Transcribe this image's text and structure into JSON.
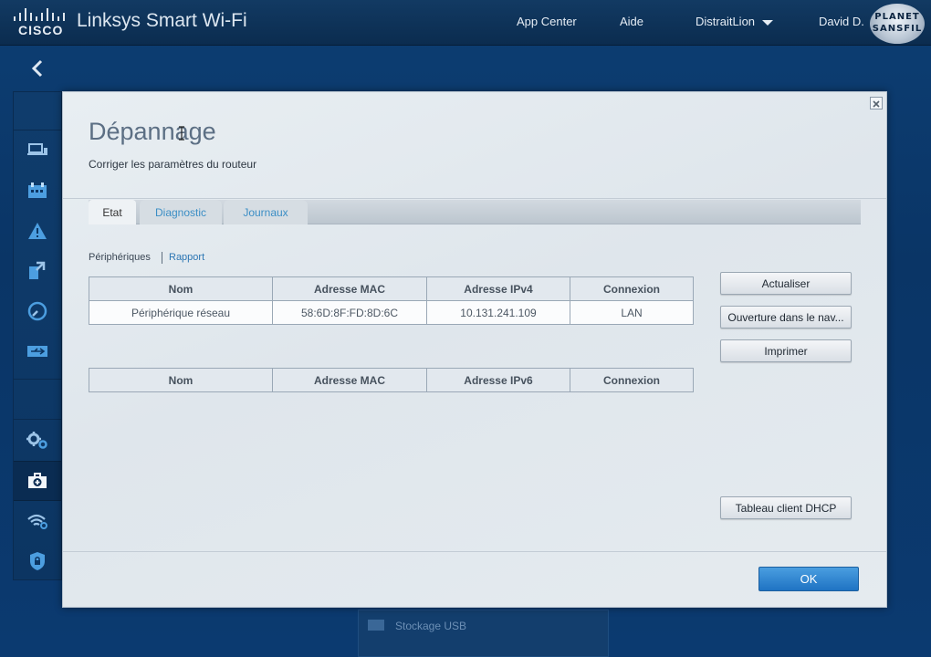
{
  "header": {
    "brand": "cisco",
    "app_title": "Linksys Smart Wi-Fi",
    "nav": {
      "app_center": "App Center",
      "help": "Aide",
      "router_name": "DistraitLion",
      "user": "David D."
    },
    "badge": {
      "line1": "PLANET",
      "line2": "SANSFIL"
    }
  },
  "sidebar": {
    "back_icon": "chevron-left-icon",
    "items": [
      {
        "icon": "devices-icon"
      },
      {
        "icon": "calendar-icon"
      },
      {
        "icon": "warning-icon"
      },
      {
        "icon": "transfer-icon"
      },
      {
        "icon": "speedometer-icon"
      },
      {
        "icon": "usb-icon"
      },
      {
        "icon": "settings-gears-icon"
      },
      {
        "icon": "first-aid-kit-icon",
        "active": true
      },
      {
        "icon": "wifi-settings-icon"
      },
      {
        "icon": "security-shield-icon"
      }
    ]
  },
  "background_widget": {
    "label": "Stockage USB"
  },
  "modal": {
    "title": "Dépannage",
    "subtitle": "Corriger les paramètres du routeur",
    "tabs": [
      {
        "label": "Etat",
        "active": true
      },
      {
        "label": "Diagnostic",
        "active": false
      },
      {
        "label": "Journaux",
        "active": false
      }
    ],
    "subnav": {
      "current": "Périphériques",
      "link": "Rapport"
    },
    "ipv4_table": {
      "headers": [
        "Nom",
        "Adresse MAC",
        "Adresse IPv4",
        "Connexion"
      ],
      "rows": [
        [
          "Périphérique réseau",
          "58:6D:8F:FD:8D:6C",
          "10.131.241.109",
          "LAN"
        ]
      ]
    },
    "ipv6_table": {
      "headers": [
        "Nom",
        "Adresse MAC",
        "Adresse IPv6",
        "Connexion"
      ]
    },
    "buttons": {
      "refresh": "Actualiser",
      "open_browser": "Ouverture dans le nav...",
      "print": "Imprimer",
      "dhcp": "Tableau client DHCP"
    },
    "ok": "OK"
  },
  "colors": {
    "accent_blue": "#2c76b3",
    "ok_button": "#1f73c3",
    "topbar": "#0b2c4f",
    "background": "#0a3566"
  }
}
